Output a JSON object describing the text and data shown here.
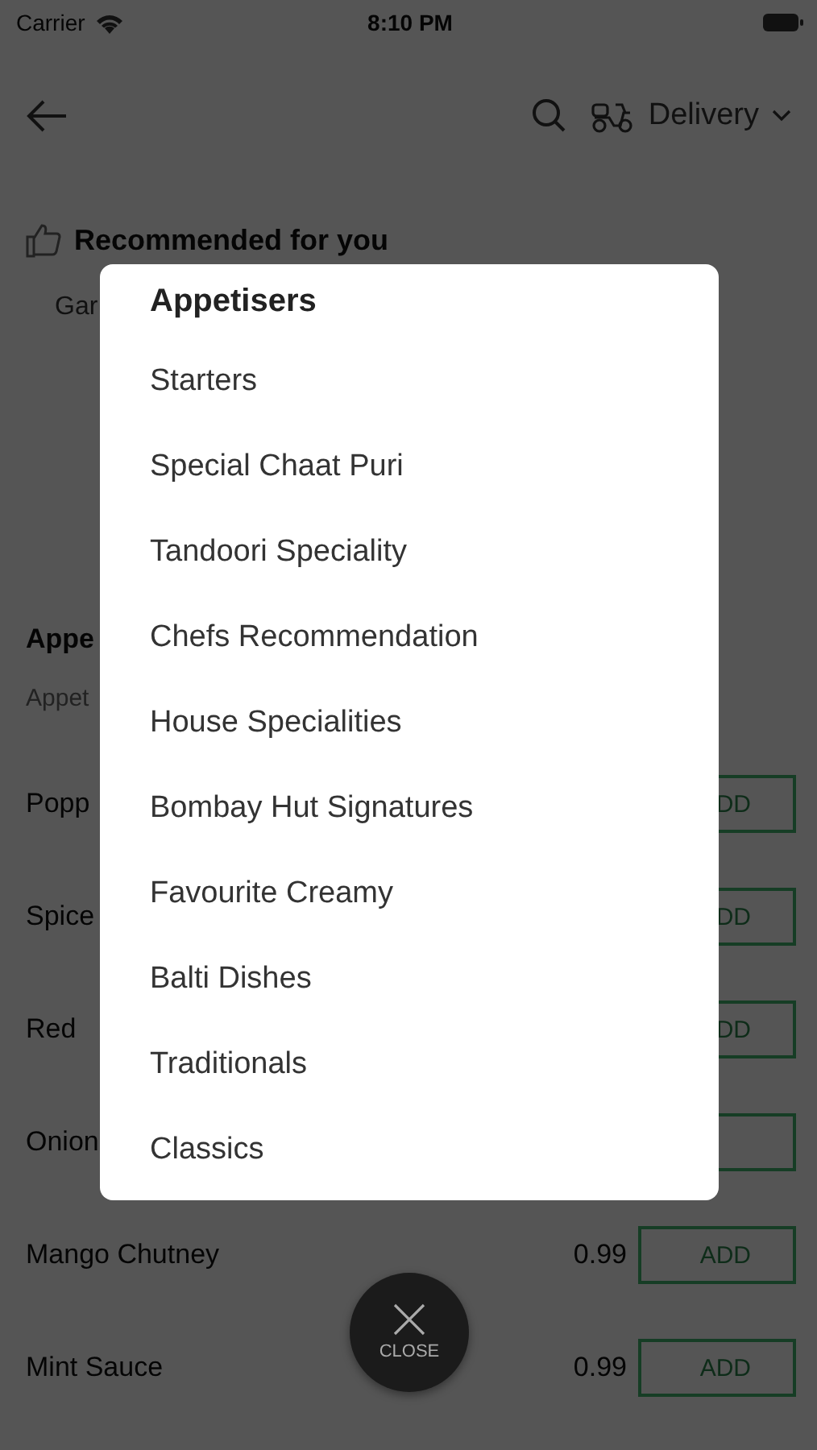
{
  "status_bar": {
    "carrier": "Carrier",
    "time": "8:10 PM"
  },
  "header": {
    "order_type": "Delivery"
  },
  "recommended": {
    "title": "Recommended for you",
    "items": [
      "Gar"
    ]
  },
  "section": {
    "title": "Appe",
    "subtitle": "Appet"
  },
  "items": [
    {
      "name": "Popp",
      "add": "DD"
    },
    {
      "name": "Spice",
      "add": "DD"
    },
    {
      "name": "Red",
      "add": "DD"
    },
    {
      "name": "Onion"
    },
    {
      "name": "Mango Chutney",
      "price": "0.99",
      "add": "ADD"
    },
    {
      "name": "Mint Sauce",
      "price": "0.99",
      "add": "ADD"
    }
  ],
  "menu": {
    "title": "Appetisers",
    "items": [
      "Starters",
      "Special Chaat Puri",
      "Tandoori Speciality",
      "Chefs Recommendation",
      "House Specialities",
      "Bombay Hut Signatures",
      "Favourite Creamy",
      "Balti Dishes",
      "Traditionals",
      "Classics"
    ]
  },
  "close_button": {
    "label": "CLOSE"
  }
}
